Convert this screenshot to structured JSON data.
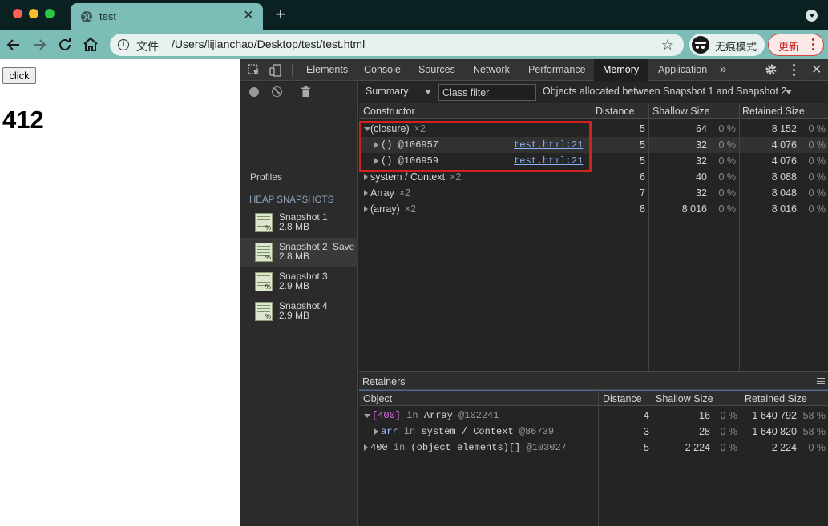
{
  "browser": {
    "tab_title": "test",
    "omnibox_scheme_label": "文件",
    "url": "/Users/lijianchao/Desktop/test/test.html",
    "incognito_label": "无痕模式",
    "update_label": "更新"
  },
  "page": {
    "button_label": "click",
    "counter": "412"
  },
  "devtools": {
    "tabs": [
      "Elements",
      "Console",
      "Sources",
      "Network",
      "Performance",
      "Memory",
      "Application"
    ],
    "active_tab": "Memory",
    "more": "»",
    "close": "✕",
    "profiles_title": "Profiles",
    "heap_snapshots_title": "HEAP SNAPSHOTS",
    "snapshots": [
      {
        "name": "Snapshot 1",
        "size": "2.8 MB"
      },
      {
        "name": "Snapshot 2",
        "size": "2.8 MB",
        "save": "Save"
      },
      {
        "name": "Snapshot 3",
        "size": "2.9 MB"
      },
      {
        "name": "Snapshot 4",
        "size": "2.9 MB"
      }
    ],
    "view_mode": "Summary",
    "class_filter_placeholder": "Class filter",
    "allocation_filter": "Objects allocated between Snapshot 1 and Snapshot 2",
    "columns": {
      "constructor": "Constructor",
      "distance": "Distance",
      "shallow": "Shallow Size",
      "retained": "Retained Size"
    },
    "rows": [
      {
        "name": "(closure)",
        "mult": "×2",
        "distance": "5",
        "shallow": "64",
        "shallow_pct": "0 %",
        "retained": "8 152",
        "retained_pct": "0 %"
      },
      {
        "name": "() @106957",
        "link": "test.html:21",
        "distance": "5",
        "shallow": "32",
        "shallow_pct": "0 %",
        "retained": "4 076",
        "retained_pct": "0 %"
      },
      {
        "name": "() @106959",
        "link": "test.html:21",
        "distance": "5",
        "shallow": "32",
        "shallow_pct": "0 %",
        "retained": "4 076",
        "retained_pct": "0 %"
      },
      {
        "name": "system / Context",
        "mult": "×2",
        "distance": "6",
        "shallow": "40",
        "shallow_pct": "0 %",
        "retained": "8 088",
        "retained_pct": "0 %"
      },
      {
        "name": "Array",
        "mult": "×2",
        "distance": "7",
        "shallow": "32",
        "shallow_pct": "0 %",
        "retained": "8 048",
        "retained_pct": "0 %"
      },
      {
        "name": "(array)",
        "mult": "×2",
        "distance": "8",
        "shallow": "8 016",
        "shallow_pct": "0 %",
        "retained": "8 016",
        "retained_pct": "0 %"
      }
    ],
    "retainers_title": "Retainers",
    "ret_columns": {
      "object": "Object",
      "distance": "Distance",
      "shallow": "Shallow Size",
      "retained": "Retained Size"
    },
    "ret_rows": [
      {
        "a": "[400]",
        "b": " in ",
        "c": "Array",
        "d": " @102241",
        "distance": "4",
        "shallow": "16",
        "shallow_pct": "0 %",
        "retained": "1 640 792",
        "retained_pct": "58 %"
      },
      {
        "a": "arr",
        "b": " in ",
        "c": "system / Context",
        "d": " @86739",
        "distance": "3",
        "shallow": "28",
        "shallow_pct": "0 %",
        "retained": "1 640 820",
        "retained_pct": "58 %"
      },
      {
        "a": "400",
        "b": " in ",
        "c": "(object elements)[]",
        "d": " @103027",
        "distance": "5",
        "shallow": "2 224",
        "shallow_pct": "0 %",
        "retained": "2 224",
        "retained_pct": "0 %"
      }
    ]
  }
}
